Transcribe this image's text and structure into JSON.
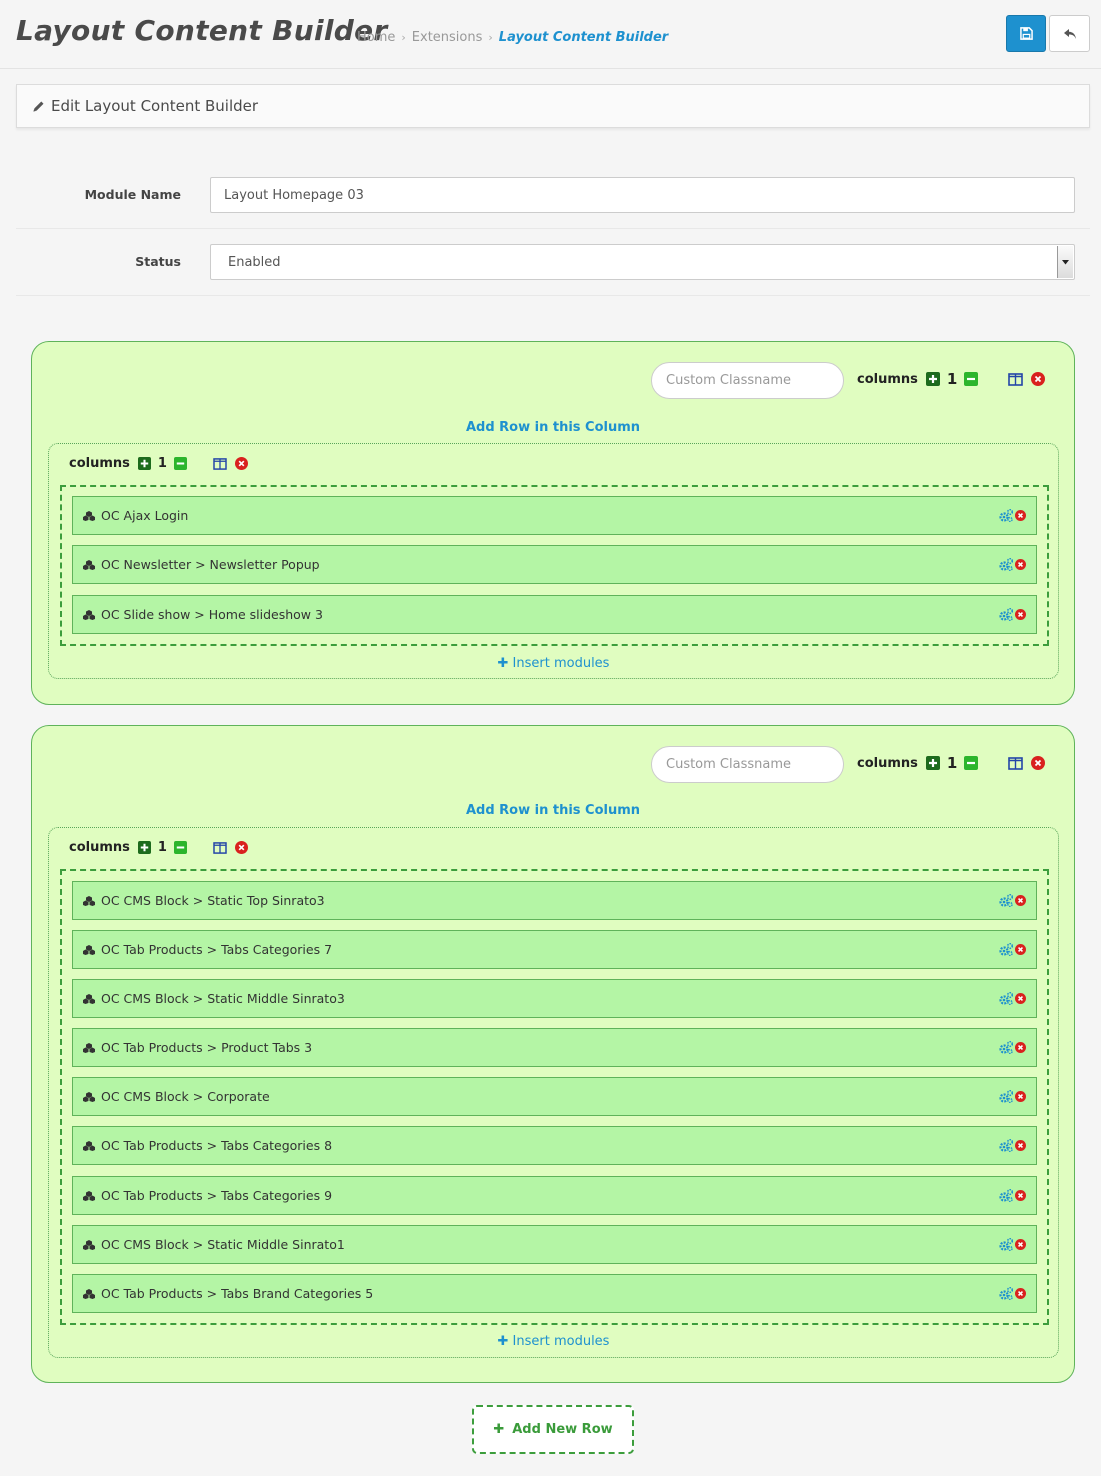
{
  "header": {
    "title": "Layout Content Builder",
    "breadcrumb": [
      "Home",
      "Extensions",
      "Layout Content Builder"
    ],
    "breadcrumb_separator": "›",
    "save_icon": "save-icon",
    "back_icon": "reply-icon"
  },
  "panel": {
    "heading": "Edit Layout Content Builder",
    "icon": "pencil-icon"
  },
  "form": {
    "module_name_label": "Module Name",
    "module_name_value": "Layout Homepage 03",
    "status_label": "Status",
    "status_value": "Enabled"
  },
  "rows": [
    {
      "classname_placeholder": "Custom Classname",
      "columns_label": "columns",
      "columns_count": "1",
      "add_row_label": "Add Row in this Column",
      "column": {
        "columns_label": "columns",
        "columns_count": "1",
        "modules": [
          "OC Ajax Login",
          "OC Newsletter > Newsletter Popup",
          "OC Slide show > Home slideshow 3"
        ],
        "insert_label": "Insert modules"
      }
    },
    {
      "classname_placeholder": "Custom Classname",
      "columns_label": "columns",
      "columns_count": "1",
      "add_row_label": "Add Row in this Column",
      "column": {
        "columns_label": "columns",
        "columns_count": "1",
        "modules": [
          "OC CMS Block > Static Top Sinrato3",
          "OC Tab Products > Tabs Categories 7",
          "OC CMS Block > Static Middle Sinrato3",
          "OC Tab Products > Product Tabs 3",
          "OC CMS Block > Corporate",
          "OC Tab Products > Tabs Categories 8",
          "OC Tab Products > Tabs Categories 9",
          "OC CMS Block > Static Middle Sinrato1",
          "OC Tab Products > Tabs Brand Categories 5"
        ],
        "insert_label": "Insert modules"
      }
    }
  ],
  "add_new_row_label": "Add New Row",
  "colors": {
    "accent": "#1e91cf",
    "row_bg": "#e0fdc0",
    "module_bg": "#b4f5a5",
    "green": "#3c9d3c",
    "remove_red": "#d9211e"
  }
}
